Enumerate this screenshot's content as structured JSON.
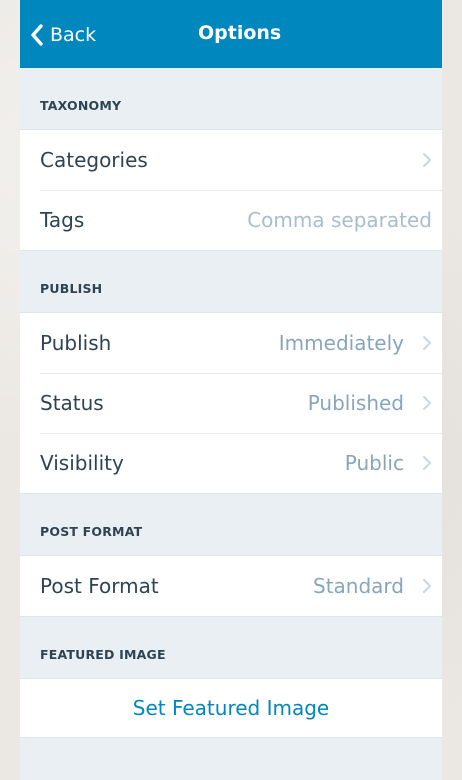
{
  "nav": {
    "back_label": "Back",
    "title": "Options"
  },
  "sections": {
    "taxonomy": {
      "header": "TAXONOMY",
      "categories_label": "Categories",
      "tags_label": "Tags",
      "tags_placeholder": "Comma separated"
    },
    "publish": {
      "header": "PUBLISH",
      "publish_label": "Publish",
      "publish_value": "Immediately",
      "status_label": "Status",
      "status_value": "Published",
      "visibility_label": "Visibility",
      "visibility_value": "Public"
    },
    "post_format": {
      "header": "POST FORMAT",
      "format_label": "Post Format",
      "format_value": "Standard"
    },
    "featured_image": {
      "header": "FEATURED IMAGE",
      "action_label": "Set Featured Image"
    }
  },
  "colors": {
    "navbar": "#0087be",
    "accent": "#0087be",
    "background": "#e9eff3",
    "text_primary": "#2e4453",
    "text_secondary": "#87a6bc"
  },
  "icons": {
    "back": "chevron-left-icon",
    "disclosure": "chevron-right-icon"
  }
}
